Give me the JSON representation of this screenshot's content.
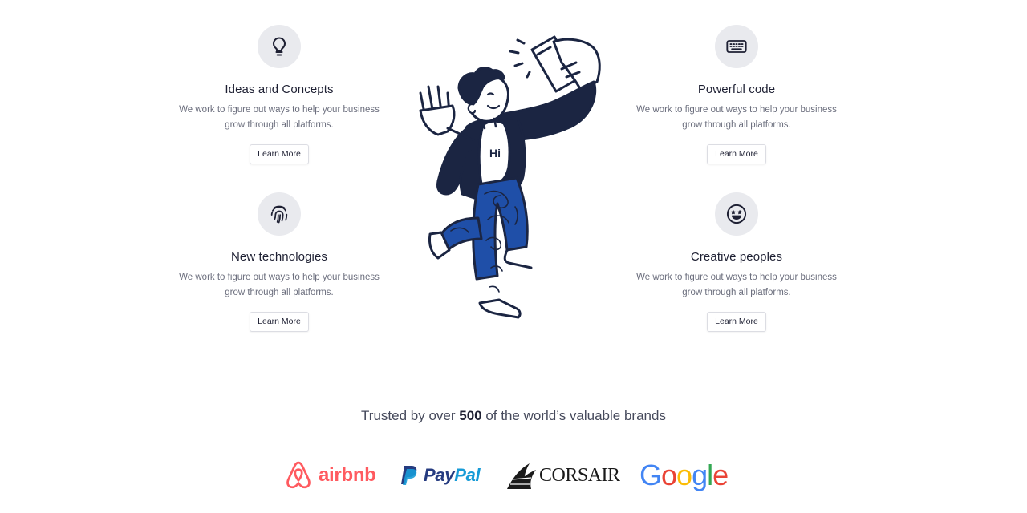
{
  "features": [
    {
      "title": "Ideas and Concepts",
      "desc": "We work to figure out ways to help your business grow through all platforms.",
      "button": "Learn More",
      "icon": "lightbulb-icon"
    },
    {
      "title": "Powerful code",
      "desc": "We work to figure out ways to help your business grow through all platforms.",
      "button": "Learn More",
      "icon": "keyboard-icon"
    },
    {
      "title": "New technologies",
      "desc": "We work to figure out ways to help your business grow through all platforms.",
      "button": "Learn More",
      "icon": "fingerprint-icon"
    },
    {
      "title": "Creative peoples",
      "desc": "We work to figure out ways to help your business grow through all platforms.",
      "button": "Learn More",
      "icon": "star-eyes-smiley-icon"
    }
  ],
  "hero": {
    "shirt_text": "Hi"
  },
  "trusted": {
    "prefix": "Trusted by over ",
    "count": "500",
    "suffix": " of the world’s valuable brands"
  },
  "brands": {
    "airbnb": "airbnb",
    "paypal_pay": "Pay",
    "paypal_pal": "Pal",
    "corsair": "CORSAIR",
    "google": [
      "G",
      "o",
      "o",
      "g",
      "l",
      "e"
    ]
  },
  "colors": {
    "icon_bg": "#e9eaee",
    "text_dark": "#1e2033",
    "text_muted": "#6b6e7d",
    "figure_navy": "#1b2542",
    "figure_blue": "#1f4fa8",
    "airbnb": "#ff5a5f",
    "paypal_dark": "#253b80",
    "paypal_light": "#179bd7"
  }
}
